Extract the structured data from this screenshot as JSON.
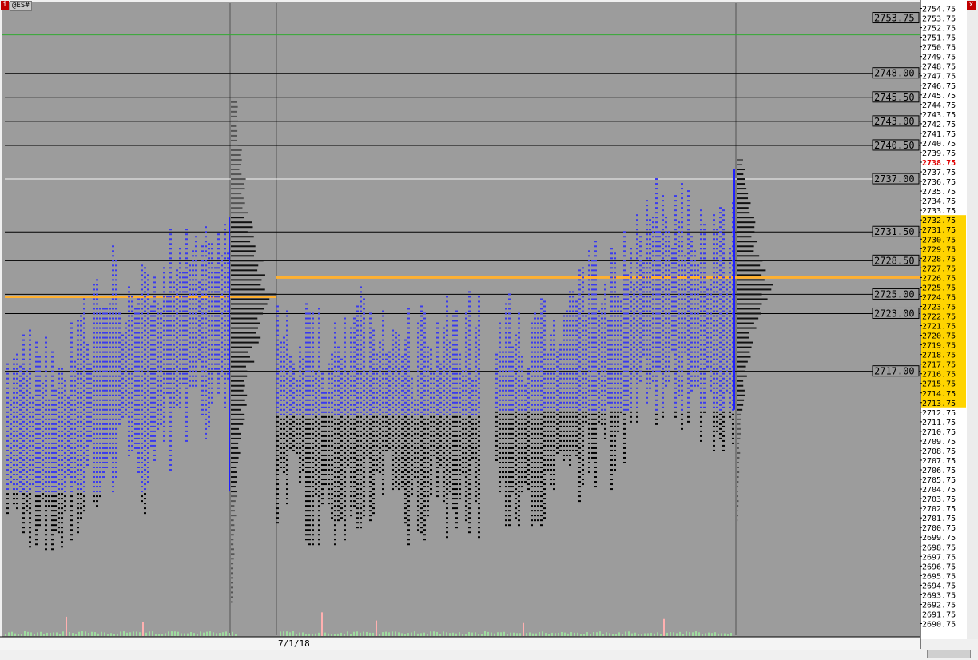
{
  "window": {
    "symbol": "@ES#",
    "menu_icon": "i",
    "close_icon": "x"
  },
  "chart_data": {
    "type": "market-profile",
    "instrument": "@ES#",
    "price_axis": {
      "min": 2690.75,
      "max": 2754.75,
      "step": 1,
      "highlighted_price": "2738.75"
    },
    "value_area_band": {
      "low": 2713.75,
      "high": 2732.75
    },
    "date_labels": [
      "7/1/18"
    ],
    "reference_levels": [
      "2753.75",
      "2748.00",
      "2745.50",
      "2743.00",
      "2740.50",
      "2737.00",
      "2731.50",
      "2728.50",
      "2725.00",
      "2723.00",
      "2717.00"
    ],
    "poc_lines": [
      2724.75,
      2726.75
    ],
    "green_line": 2752.0,
    "sessions": [
      {
        "name": "session-1",
        "low": 2693.0,
        "high": 2745.0,
        "value_area": [
          2704.5,
          2733.0
        ],
        "poc": 2724.75
      },
      {
        "name": "session-2",
        "low": 2699.0,
        "high": 2740.5,
        "value_area": [
          2712.5,
          2729.5
        ],
        "poc": 2726.75
      },
      {
        "name": "session-3",
        "low": 2701.0,
        "high": 2739.0,
        "value_area": [
          2713.0,
          2738.0
        ],
        "poc": 2726.75
      }
    ]
  }
}
